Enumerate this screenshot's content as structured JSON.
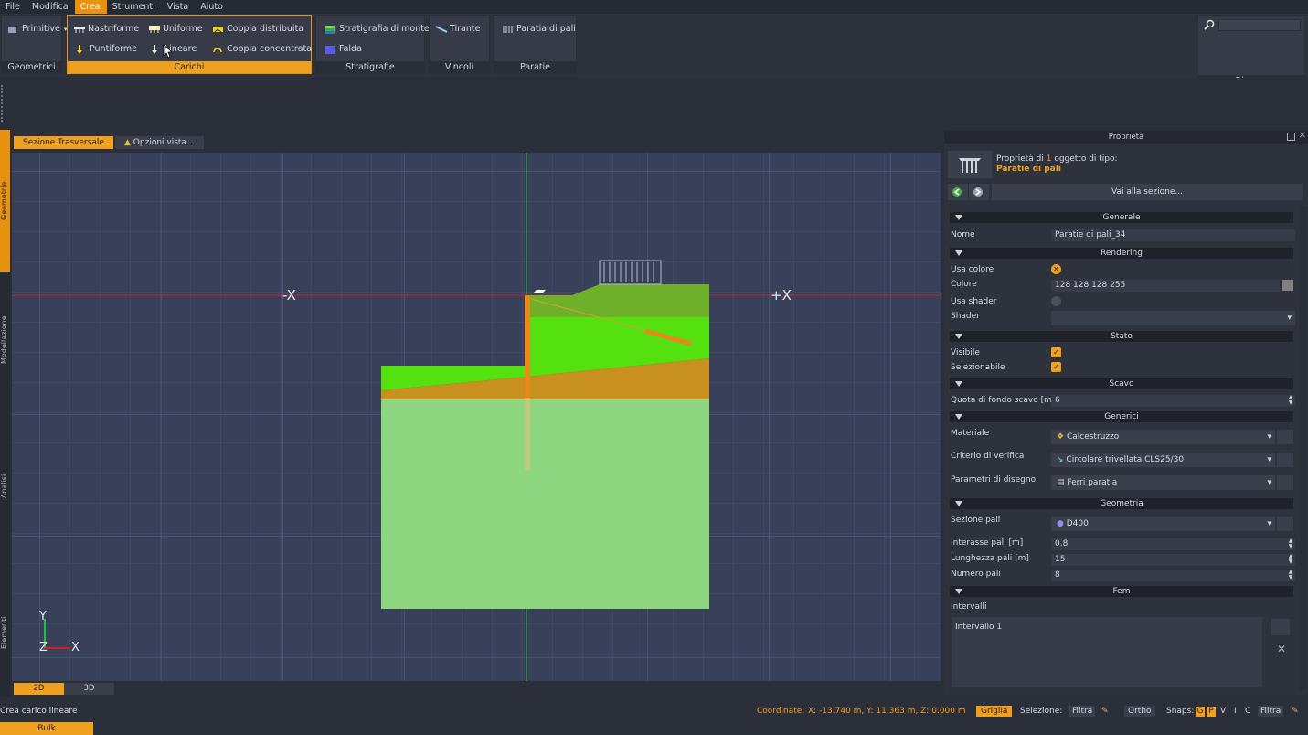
{
  "menu": [
    "File",
    "Modifica",
    "Crea",
    "Strumenti",
    "Vista",
    "Aiuto"
  ],
  "ribbon": {
    "geometrici": {
      "title": "Geometrici",
      "primitive": "Primitive"
    },
    "carichi": {
      "title": "Carichi",
      "nastriforme": "Nastriforme",
      "uniforme": "Uniforme",
      "coppia_distribuita": "Coppia distribuita",
      "puntiforme": "Puntiforme",
      "lineare": "Lineare",
      "coppia_concentrata": "Coppia concentrata"
    },
    "stratigrafie": {
      "title": "Stratigrafie",
      "stratigrafia_monte": "Stratigrafia di monte",
      "falda": "Falda"
    },
    "vincoli": {
      "title": "Vincoli",
      "tirante": "Tirante"
    },
    "paratie": {
      "title": "Paratie",
      "paratia_pali": "Paratia di pali"
    },
    "ricerca": {
      "title": "Ricerca"
    }
  },
  "left_tabs": [
    "Geometrie",
    "Modellazione",
    "Analisi",
    "Elementi"
  ],
  "view": {
    "tabs": [
      "Sezione Trasversale",
      "Opzioni vista..."
    ],
    "axis_minus": "-X",
    "axis_plus": "+X",
    "gizmo": {
      "y": "Y",
      "z": "Z",
      "x": "X"
    },
    "mode_2d": "2D",
    "mode_3d": "3D"
  },
  "props": {
    "window_title": "Proprietà",
    "type_line1_a": "Proprietà di ",
    "type_count": "1",
    "type_line1_b": " oggetto di tipo:",
    "type_line2": "Paratie di pali",
    "goto": "Vai alla sezione...",
    "sections": {
      "generale": "Generale",
      "rendering": "Rendering",
      "stato": "Stato",
      "scavo": "Scavo",
      "generici": "Generici",
      "geometria": "Geometria",
      "fem": "Fem"
    },
    "labels": {
      "nome": "Nome",
      "usa_colore": "Usa colore",
      "colore": "Colore",
      "usa_shader": "Usa shader",
      "shader": "Shader",
      "visibile": "Visibile",
      "selezionabile": "Selezionabile",
      "quota": "Quota di fondo scavo [m]",
      "materiale": "Materiale",
      "criterio": "Criterio di verifica",
      "parametri": "Parametri di disegno",
      "sezione_pali": "Sezione pali",
      "interasse": "Interasse pali [m]",
      "lunghezza": "Lunghezza pali [m]",
      "numero": "Numero pali",
      "intervalli": "Intervalli"
    },
    "values": {
      "nome": "Paratie di pali_34",
      "colore": "128 128 128 255",
      "quota": "6",
      "materiale": "Calcestruzzo",
      "criterio": "Circolare trivellata CLS25/30",
      "parametri": "Ferri paratia",
      "sezione_pali": "D400",
      "interasse": "0.8",
      "lunghezza": "15",
      "numero": "8",
      "intervallo": "Intervallo 1"
    }
  },
  "status": {
    "hint": "Crea carico lineare",
    "coord_label": "Coordinate:",
    "coord_value": "X: -13.740 m, Y: 11.363 m, Z: 0.000 m",
    "griglia": "Griglia",
    "selezione": "Selezione:",
    "filtra": "Filtra",
    "ortho": "Ortho",
    "snaps": "Snaps:",
    "snap_keys": [
      "G",
      "P",
      "V",
      "I",
      "C"
    ],
    "filtra2": "Filtra",
    "bulk": "Bulk"
  },
  "colors": {
    "accent": "#f0a020",
    "soil_green": "#55e010",
    "soil_top": "#6fb02a",
    "soil_brown": "#c8901e",
    "soil_base": "#8fd680",
    "pile": "#e88a1a"
  }
}
